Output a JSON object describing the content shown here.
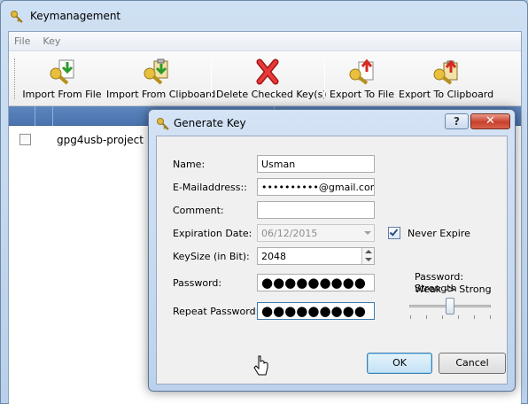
{
  "main_window": {
    "title": "Keymanagement",
    "menu": [
      "File",
      "Key"
    ],
    "toolbar": [
      {
        "label": "Import From File",
        "icon": "key-import-file-icon"
      },
      {
        "label": "Import From Clipboard",
        "icon": "key-import-clipboard-icon"
      },
      {
        "label": "Delete Checked Key(s)",
        "icon": "delete-x-icon"
      },
      {
        "label": "Export To File",
        "icon": "key-export-file-icon"
      },
      {
        "label": "Export To Clipboard",
        "icon": "key-export-clipboard-icon"
      }
    ],
    "keys": [
      {
        "name": "gpg4usb-project",
        "checked": false
      }
    ]
  },
  "dialog": {
    "title": "Generate Key",
    "help": "?",
    "close": "✕",
    "name_label": "Name:",
    "name_value": "Usman",
    "email_label": "E-Mailaddress::",
    "email_value": "••••••••••@gmail.com",
    "comment_label": "Comment:",
    "comment_value": "",
    "expiration_label": "Expiration Date:",
    "expiration_value": "06/12/2015",
    "never_expire_label": "Never Expire",
    "never_expire_checked": true,
    "keysize_label": "KeySize (in Bit):",
    "keysize_value": "2048",
    "password_label": "Password:",
    "password_value": "●●●●●●●●●",
    "repeat_label": "Repeat Password:",
    "repeat_value": "●●●●●●●●●",
    "strength_title": "Password: Strength",
    "strength_range": "Weak -> Strong",
    "ok_label": "OK",
    "cancel_label": "Cancel"
  },
  "colors": {
    "accent": "#4a73ad",
    "close_button": "#c8402d",
    "ok_border": "#3c7fb1"
  }
}
